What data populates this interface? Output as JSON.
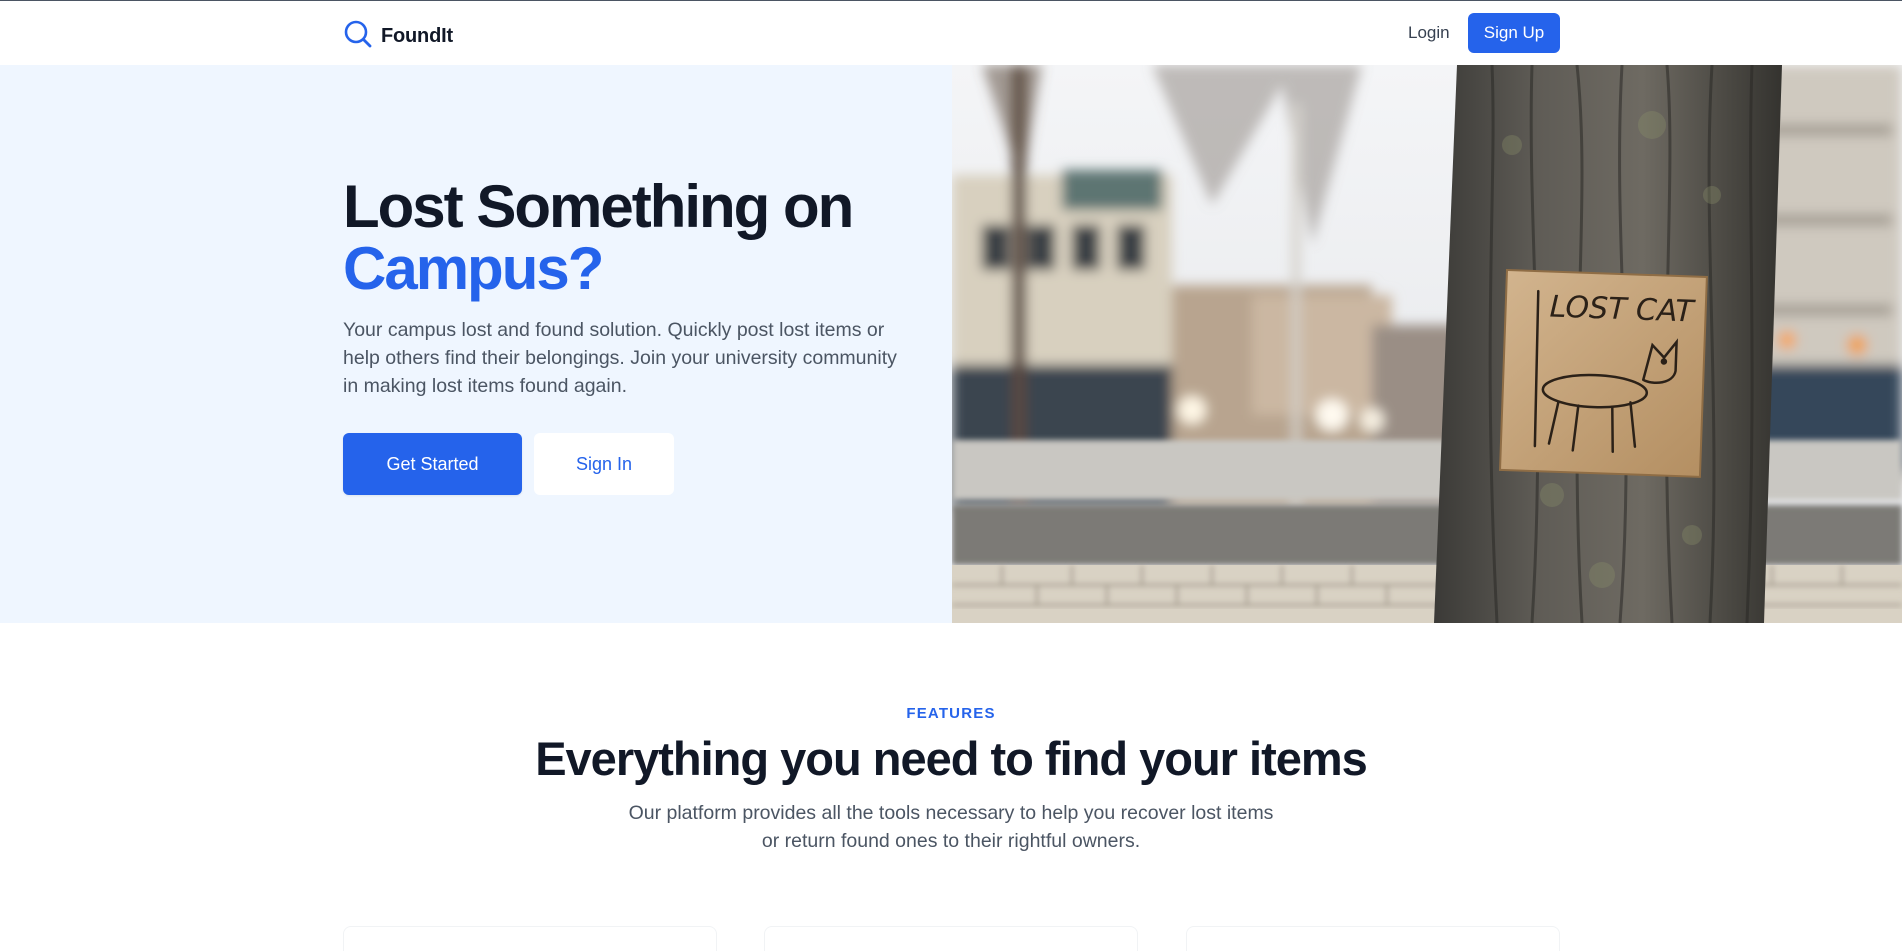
{
  "nav": {
    "brand_name": "FoundIt",
    "login_label": "Login",
    "signup_label": "Sign Up"
  },
  "hero": {
    "title_line1": "Lost Something on",
    "title_line2": "Campus?",
    "subtitle": "Your campus lost and found solution. Quickly post lost items or help others find their belongings. Join your university community in making lost items found again.",
    "primary_cta": "Get Started",
    "secondary_cta": "Sign In",
    "image_sign_text": "LOST CAT"
  },
  "features": {
    "eyebrow": "FEATURES",
    "title": "Everything you need to find your items",
    "subtitle": "Our platform provides all the tools necessary to help you recover lost items or return found ones to their rightful owners."
  },
  "colors": {
    "accent": "#2563eb",
    "hero_bg": "#eff6ff",
    "heading": "#111827",
    "body_text": "#4b5563"
  },
  "icons": {
    "brand_icon": "search-icon"
  }
}
